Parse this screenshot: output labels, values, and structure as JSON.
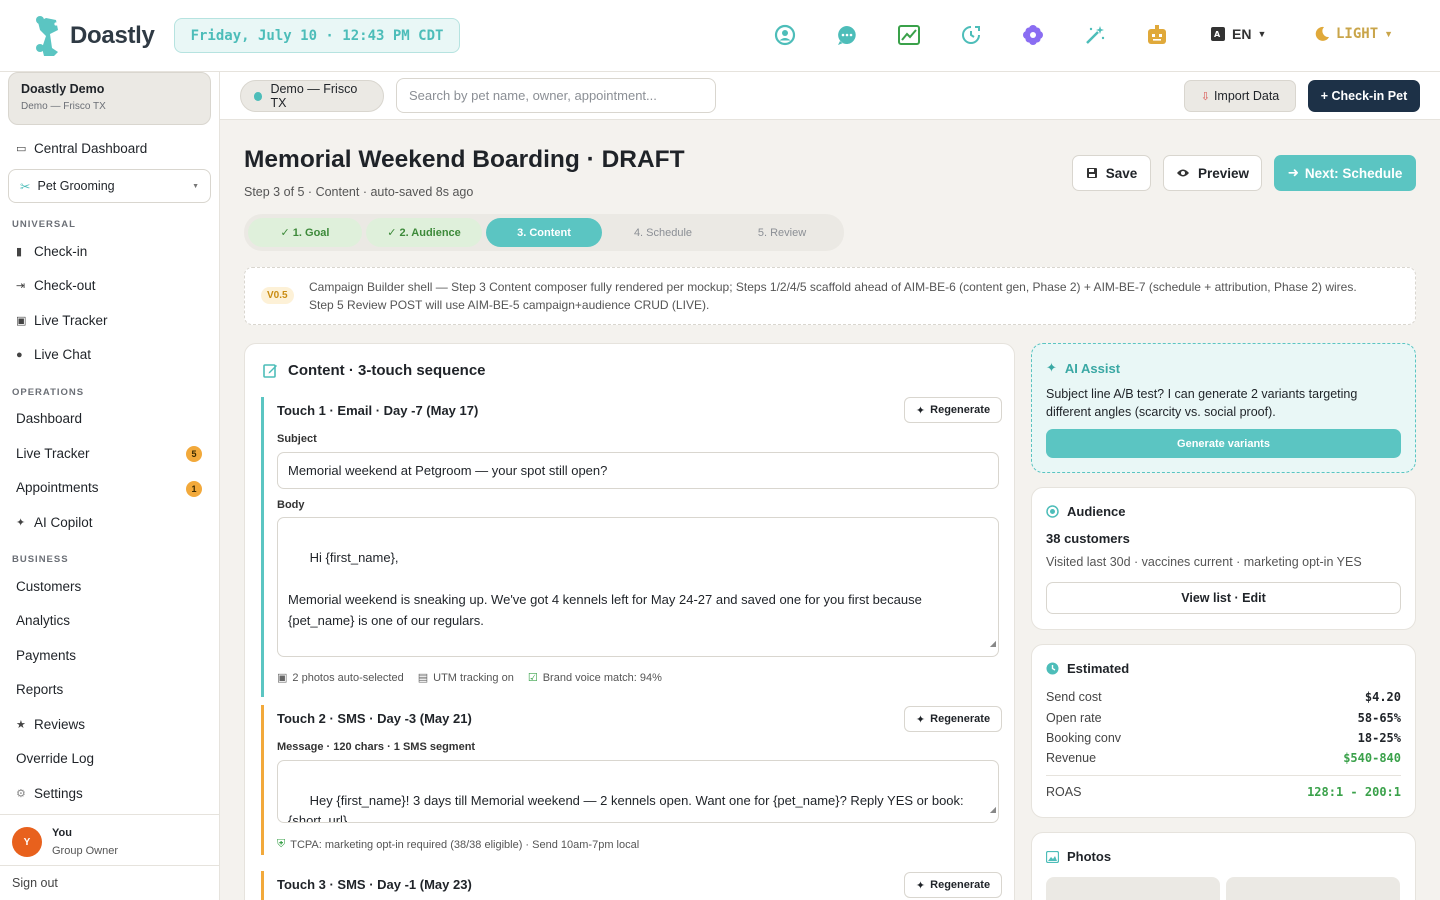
{
  "app": {
    "name": "Doastly",
    "datetime": "Friday, July 10 · 12:43 PM CDT",
    "lang": "EN",
    "theme": "LIGHT"
  },
  "sidebar": {
    "org_name": "Doastly Demo",
    "org_sub": "Demo — Frisco TX",
    "central_dashboard": "Central Dashboard",
    "vertical_select": "Pet Grooming",
    "sections": {
      "universal": "UNIVERSAL",
      "operations": "OPERATIONS",
      "business": "BUSINESS"
    },
    "universal_items": [
      "Check-in",
      "Check-out",
      "Live Tracker",
      "Live Chat"
    ],
    "operations_items": [
      "Dashboard",
      "Live Tracker",
      "Appointments",
      "AI Copilot"
    ],
    "badges": {
      "live_tracker": "5",
      "appointments": "1"
    },
    "business_items": [
      "Customers",
      "Analytics",
      "Payments",
      "Reports",
      "Reviews",
      "Override Log",
      "Settings"
    ],
    "user": {
      "initial": "Y",
      "name": "You",
      "role": "Group Owner"
    },
    "sign_out": "Sign out"
  },
  "subheader": {
    "location": "Demo — Frisco TX",
    "search_placeholder": "Search by pet name, owner, appointment...",
    "import_label": "Import Data",
    "checkin_label": "+ Check-in Pet"
  },
  "page": {
    "title": "Memorial Weekend Boarding · DRAFT",
    "subtitle": "Step 3 of 5 · Content · auto-saved 8s ago",
    "save_label": "Save",
    "preview_label": "Preview",
    "next_label": "Next: Schedule",
    "steps": [
      "✓ 1. Goal",
      "✓ 2. Audience",
      "3. Content",
      "4. Schedule",
      "5. Review"
    ],
    "version": "V0.5",
    "notice_line1": "Campaign Builder shell — Step 3 Content composer fully rendered per mockup; Steps 1/2/4/5 scaffold ahead of AIM-BE-6 (content gen, Phase 2) + AIM-BE-7 (schedule + attribution, Phase 2) wires.",
    "notice_line2": "Step 5 Review POST will use AIM-BE-5 campaign+audience CRUD (LIVE)."
  },
  "content": {
    "title": "Content · 3-touch sequence",
    "regenerate_label": "Regenerate",
    "touch1": {
      "title": "Touch 1 · Email · Day -7 (May 17)",
      "subject_label": "Subject",
      "subject": "Memorial weekend at Petgroom — your spot still open?",
      "body_label": "Body",
      "body": "Hi {first_name},\n\nMemorial weekend is sneaking up. We've got 4 kennels left for May 24-27 and saved one for you first because\n{pet_name} is one of our regulars.\n\nWhat you get:",
      "meta": [
        "2 photos auto-selected",
        "UTM tracking on",
        "Brand voice match: 94%"
      ]
    },
    "touch2": {
      "title": "Touch 2 · SMS · Day -3 (May 21)",
      "message_label": "Message · 120 chars · 1 SMS segment",
      "message": "Hey {first_name}! 3 days till Memorial weekend — 2 kennels open. Want one for {pet_name}? Reply YES or book:\n{short_url}",
      "meta": "TCPA: marketing opt-in required (38/38 eligible) · Send 10am-7pm local"
    },
    "touch3": {
      "title": "Touch 3 · SMS · Day -1 (May 23)"
    }
  },
  "ai_assist": {
    "title": "AI Assist",
    "text_line1": "Subject line A/B test? I can generate 2 variants targeting",
    "text_line2": "different angles (scarcity vs. social proof).",
    "button": "Generate variants"
  },
  "audience": {
    "title": "Audience",
    "count": "38 customers",
    "criteria": "Visited last 30d · vaccines current · marketing opt-in YES",
    "button": "View list · Edit"
  },
  "estimated": {
    "title": "Estimated",
    "rows": [
      {
        "label": "Send cost",
        "value": "$4.20"
      },
      {
        "label": "Open rate",
        "value": "58-65%"
      },
      {
        "label": "Booking conv",
        "value": "18-25%"
      },
      {
        "label": "Revenue",
        "value": "$540-840"
      }
    ],
    "roas_label": "ROAS",
    "roas_value": "128:1 - 200:1"
  },
  "photos": {
    "title": "Photos"
  },
  "colors": {
    "accent": "#5bc5c2",
    "navy": "#1d3147",
    "amber": "#f2a93b",
    "green": "#3aa14a"
  }
}
